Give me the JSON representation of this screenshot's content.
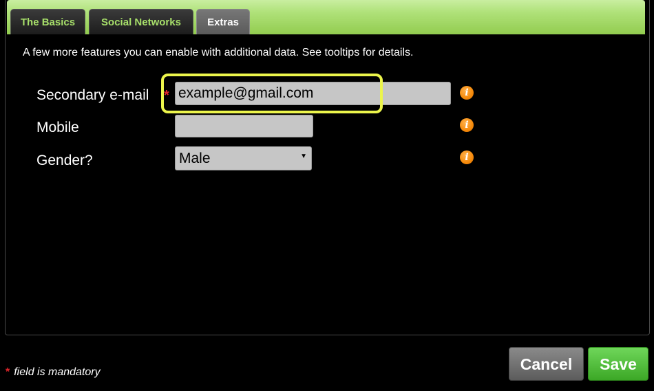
{
  "tabs": [
    {
      "label": "The Basics",
      "active": false
    },
    {
      "label": "Social Networks",
      "active": false
    },
    {
      "label": "Extras",
      "active": true
    }
  ],
  "intro_text": "A few more features you can enable with additional data. See tooltips for details.",
  "form": {
    "secondary_email": {
      "label": "Secondary e-mail",
      "required_marker": "*",
      "value": "example@gmail.com",
      "info_icon": "info-icon"
    },
    "mobile": {
      "label": "Mobile",
      "value": "",
      "info_icon": "info-icon"
    },
    "gender": {
      "label": "Gender?",
      "selected": "Male",
      "info_icon": "info-icon"
    }
  },
  "footer": {
    "required_marker": "*",
    "mandatory_note": "field is mandatory",
    "cancel_label": "Cancel",
    "save_label": "Save"
  },
  "colors": {
    "tab_bar": "#b0e27a",
    "tab_inactive_text": "#a7df6a",
    "highlight": "#ecf54b",
    "required": "#e0262b",
    "info": "#f58a0b",
    "save": "#4ab833",
    "cancel": "#6f6f6f"
  }
}
